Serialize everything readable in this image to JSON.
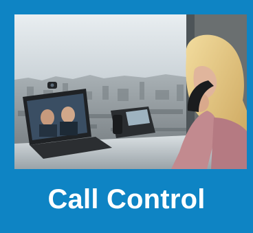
{
  "tile": {
    "caption": "Call Control",
    "image_subject": "person-on-phone-with-laptop-video-call-city-view",
    "colors": {
      "frame": "#0e84c4",
      "caption_text": "#ffffff"
    }
  }
}
